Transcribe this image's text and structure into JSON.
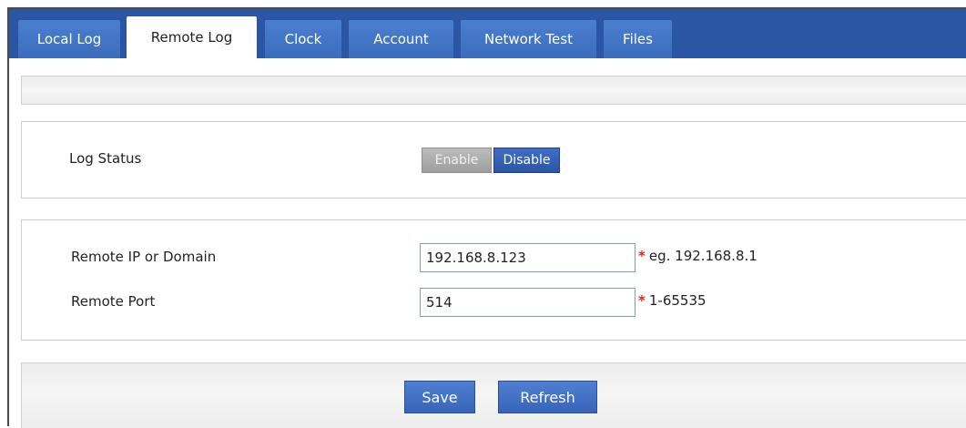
{
  "tabs": [
    {
      "label": "Local Log",
      "active": false
    },
    {
      "label": "Remote Log",
      "active": true
    },
    {
      "label": "Clock",
      "active": false
    },
    {
      "label": "Account",
      "active": false
    },
    {
      "label": "Network Test",
      "active": false
    },
    {
      "label": "Files",
      "active": false
    }
  ],
  "log_status": {
    "label": "Log Status",
    "enable_label": "Enable",
    "disable_label": "Disable",
    "selected": "Disable"
  },
  "remote": {
    "ip_label": "Remote IP or Domain",
    "ip_value": "192.168.8.123",
    "ip_hint": "eg. 192.168.8.1",
    "port_label": "Remote Port",
    "port_value": "514",
    "port_hint": "1-65535",
    "required_mark": "*"
  },
  "actions": {
    "save_label": "Save",
    "refresh_label": "Refresh"
  },
  "colors": {
    "tabbar": "#2b56a3",
    "tab": "#4a7fd0",
    "required": "#e0261e"
  }
}
